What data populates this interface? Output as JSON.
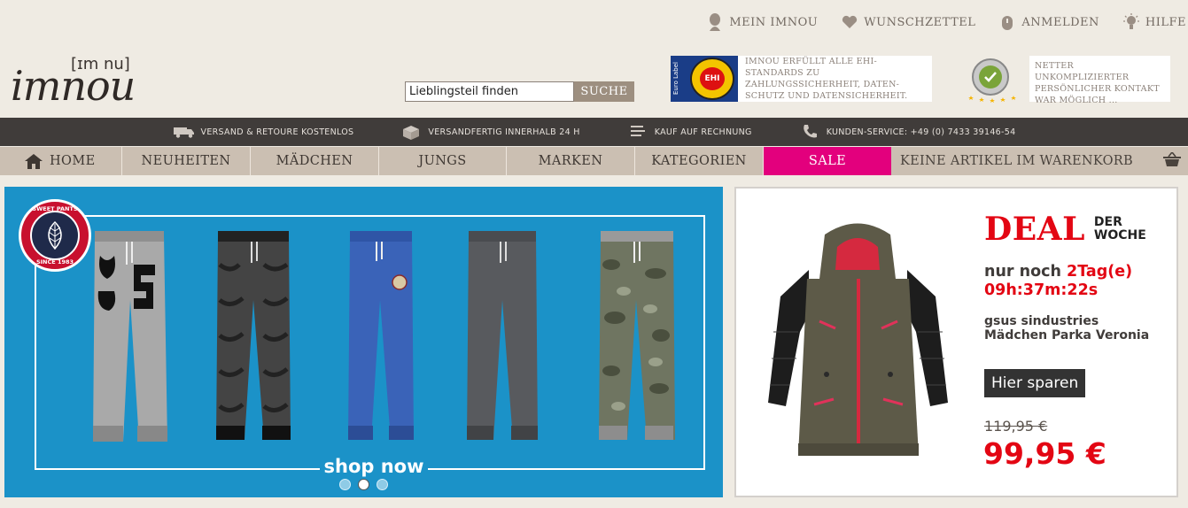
{
  "toplinks": [
    {
      "label": "MEIN IMNOU",
      "icon": "user-icon"
    },
    {
      "label": "WUNSCHZETTEL",
      "icon": "heart-icon"
    },
    {
      "label": "ANMELDEN",
      "icon": "lock-icon"
    },
    {
      "label": "HILFE",
      "icon": "lightbulb-icon"
    }
  ],
  "logo": {
    "phonetic": "[ɪm nu]",
    "wordmark": "imnou"
  },
  "search": {
    "value": "Lieblingsteil finden",
    "button_label": "SUCHE"
  },
  "trust": {
    "ehi_text": "IMNOU ERFÜLLT ALLE EHI-STANDARDS ZU ZAHLUNGSSICHERHEIT, DATEN-SCHUTZ UND DATENSICHERHEIT.",
    "ehi_badge_text": "EHI",
    "ehi_badge_side": "Euro Label",
    "review_text": "NETTER UNKOMPLIZIERTER PERSÖNLICHER KONTAKT WAR MÖGLICH ...",
    "review_stars": 5
  },
  "infobar": [
    {
      "label": "VERSAND & RETOURE KOSTENLOS",
      "icon": "truck-icon"
    },
    {
      "label": "VERSANDFERTIG INNERHALB 24 H",
      "icon": "box-icon"
    },
    {
      "label": "KAUF AUF RECHNUNG",
      "icon": "invoice-icon"
    },
    {
      "label": "KUNDEN-SERVICE: +49 (0) 7433 39146-54",
      "icon": "phone-icon"
    }
  ],
  "nav": {
    "home": "HOME",
    "items": [
      "NEUHEITEN",
      "MÄDCHEN",
      "JUNGS",
      "MARKEN",
      "KATEGORIEN"
    ],
    "sale": "SALE",
    "cart": "KEINE ARTIKEL IM WARENKORB"
  },
  "banner": {
    "brand_top": "SWEET PANTS",
    "brand_bottom": "SINCE 1983",
    "cta": "shop now",
    "slides": 3,
    "active_slide": 2
  },
  "deal": {
    "title_big": "DEAL",
    "title_small_1": "DER",
    "title_small_2": "WOCHE",
    "countdown_prefix": "nur noch ",
    "countdown_days": "2Tag(e)",
    "countdown_time": "09h:37m:22s",
    "product_line1": "gsus sindustries",
    "product_line2": "Mädchen Parka Veronia",
    "cta": "Hier sparen",
    "old_price": "119,95 €",
    "new_price": "99,95 €"
  },
  "colors": {
    "background": "#efebe3",
    "infobar": "#403c3a",
    "nav": "#cbbfb2",
    "sale": "#e3007d",
    "banner": "#1b92c8",
    "deal_red": "#e30613"
  }
}
